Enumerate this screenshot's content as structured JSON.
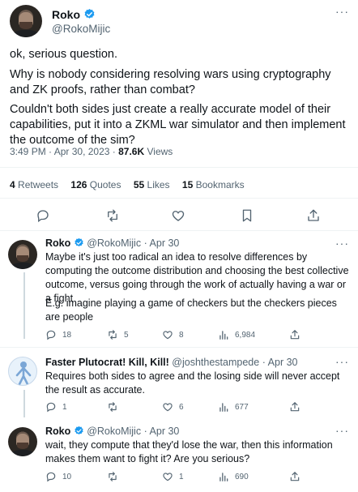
{
  "main": {
    "name": "Roko",
    "handle": "@RokoMijic",
    "paragraphs": [
      "ok, serious question.",
      "Why is nobody considering resolving wars using cryptography and ZK proofs, rather than combat?",
      "Couldn't both sides just create a really accurate model of their capabilities, put it into a ZKML war simulator and then implement the outcome of the sim?"
    ],
    "time": "3:49 PM",
    "date": "Apr 30, 2023",
    "views_count": "87.6K",
    "views_label": "Views"
  },
  "stats": {
    "retweets_count": "4",
    "retweets_label": "Retweets",
    "quotes_count": "126",
    "quotes_label": "Quotes",
    "likes_count": "55",
    "likes_label": "Likes",
    "bookmarks_count": "15",
    "bookmarks_label": "Bookmarks"
  },
  "replies": [
    {
      "name": "Roko",
      "handle": "@RokoMijic",
      "date": "Apr 30",
      "paragraphs": [
        "Maybe it's just too radical an idea to resolve differences by computing the outcome distribution and choosing the best collective outcome, versus going through the work of actually having a war or a fight",
        "E.g. imagine playing a game of checkers but the checkers pieces are people"
      ],
      "replies": "18",
      "retweets": "5",
      "likes": "8",
      "views": "6,984"
    },
    {
      "name": "Faster Plutocrat! Kill, Kill!",
      "handle": "@joshthestampede",
      "date": "Apr 30",
      "paragraphs": [
        "Requires both sides to agree and the losing side will never accept the result as accurate."
      ],
      "replies": "1",
      "retweets": "",
      "likes": "6",
      "views": "677"
    },
    {
      "name": "Roko",
      "handle": "@RokoMijic",
      "date": "Apr 30",
      "paragraphs": [
        "wait, they compute that they'd lose the war, then this information makes them want to fight it? Are you serious?"
      ],
      "replies": "10",
      "retweets": "",
      "likes": "1",
      "views": "690"
    }
  ],
  "separator": "·",
  "more_glyph": "···",
  "colors": {
    "text": "#0f1419",
    "secondary": "#536471",
    "verified": "#1d9bf0",
    "divider": "#eff3f4"
  }
}
